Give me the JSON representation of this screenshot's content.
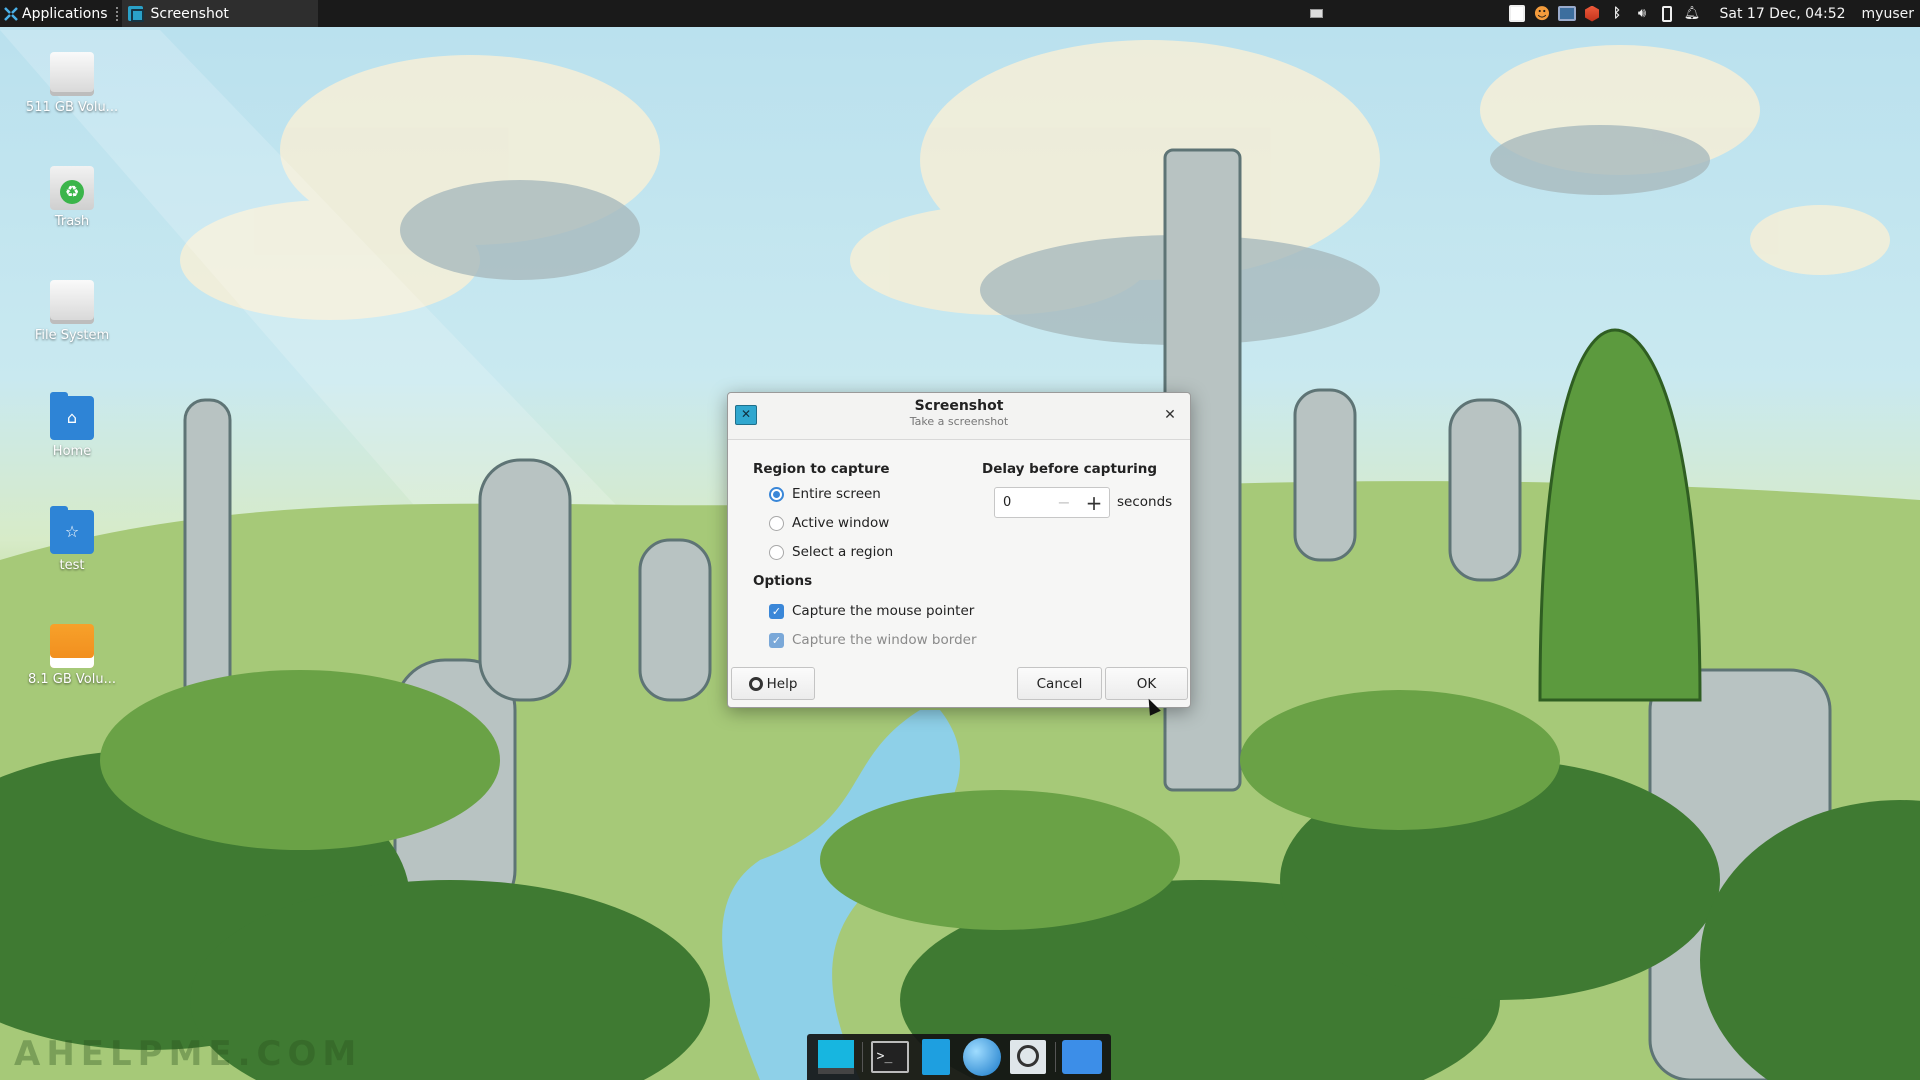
{
  "top_panel": {
    "applications_label": "Applications",
    "task_label": "Screenshot",
    "clock": "Sat 17 Dec, 04:52",
    "user": "myuser",
    "tray_icons": [
      "notes-icon",
      "update-icon",
      "network-icon",
      "shield-icon",
      "bluetooth-icon",
      "volume-icon",
      "battery-icon",
      "bell-icon"
    ]
  },
  "desktop": {
    "icons": [
      {
        "label": "511 GB Volu...",
        "icon": "drive-icon"
      },
      {
        "label": "Trash",
        "icon": "trash-icon"
      },
      {
        "label": "File System",
        "icon": "drive-icon"
      },
      {
        "label": "Home",
        "icon": "home-folder-icon"
      },
      {
        "label": "test",
        "icon": "star-folder-icon"
      },
      {
        "label": "8.1 GB Volu...",
        "icon": "usb-drive-icon"
      }
    ],
    "watermark": "AHELPME.COM"
  },
  "dialog": {
    "title": "Screenshot",
    "subtitle": "Take a screenshot",
    "region": {
      "heading": "Region to capture",
      "options": [
        "Entire screen",
        "Active window",
        "Select a region"
      ],
      "selected": "Entire screen"
    },
    "delay": {
      "heading": "Delay before capturing",
      "value": "0",
      "unit": "seconds"
    },
    "options": {
      "heading": "Options",
      "capture_pointer": "Capture the mouse pointer",
      "capture_border": "Capture the window border"
    },
    "buttons": {
      "help": "Help",
      "cancel": "Cancel",
      "ok": "OK"
    }
  },
  "dock": {
    "items": [
      "show-desktop-icon",
      "terminal-icon",
      "file-manager-icon",
      "web-browser-icon",
      "app-finder-icon",
      "folder-icon"
    ],
    "terminal_prompt": ">_"
  },
  "colors": {
    "accent": "#3a87d8",
    "panel_bg": "#1a1a1a"
  }
}
